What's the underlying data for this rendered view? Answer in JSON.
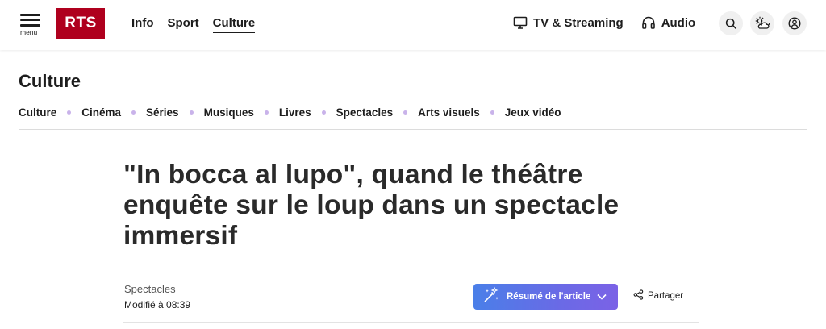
{
  "header": {
    "menu_label": "menu",
    "logo_text": "RTS",
    "nav": [
      {
        "label": "Info"
      },
      {
        "label": "Sport"
      },
      {
        "label": "Culture"
      }
    ],
    "tv_label": "TV & Streaming",
    "audio_label": "Audio"
  },
  "section": {
    "title": "Culture",
    "subnav": [
      "Culture",
      "Cinéma",
      "Séries",
      "Musiques",
      "Livres",
      "Spectacles",
      "Arts visuels",
      "Jeux vidéo"
    ]
  },
  "article": {
    "headline": "\"In bocca al lupo\", quand le théâtre enquête sur le loup dans un spectacle immersif",
    "category": "Spectacles",
    "modified": "Modifié à 08:39",
    "summary_label": "Résumé de l'article",
    "share_label": "Partager"
  },
  "colors": {
    "brand": "#af001e",
    "subnav_dot": "#c9b3ea",
    "summary_gradient_start": "#4a7fe8",
    "summary_gradient_end": "#7b62e6"
  },
  "icons": [
    "menu-icon",
    "tv-icon",
    "headphones-icon",
    "search-icon",
    "weather-icon",
    "user-icon",
    "sparkle-icon",
    "chevron-down-icon",
    "share-icon"
  ]
}
